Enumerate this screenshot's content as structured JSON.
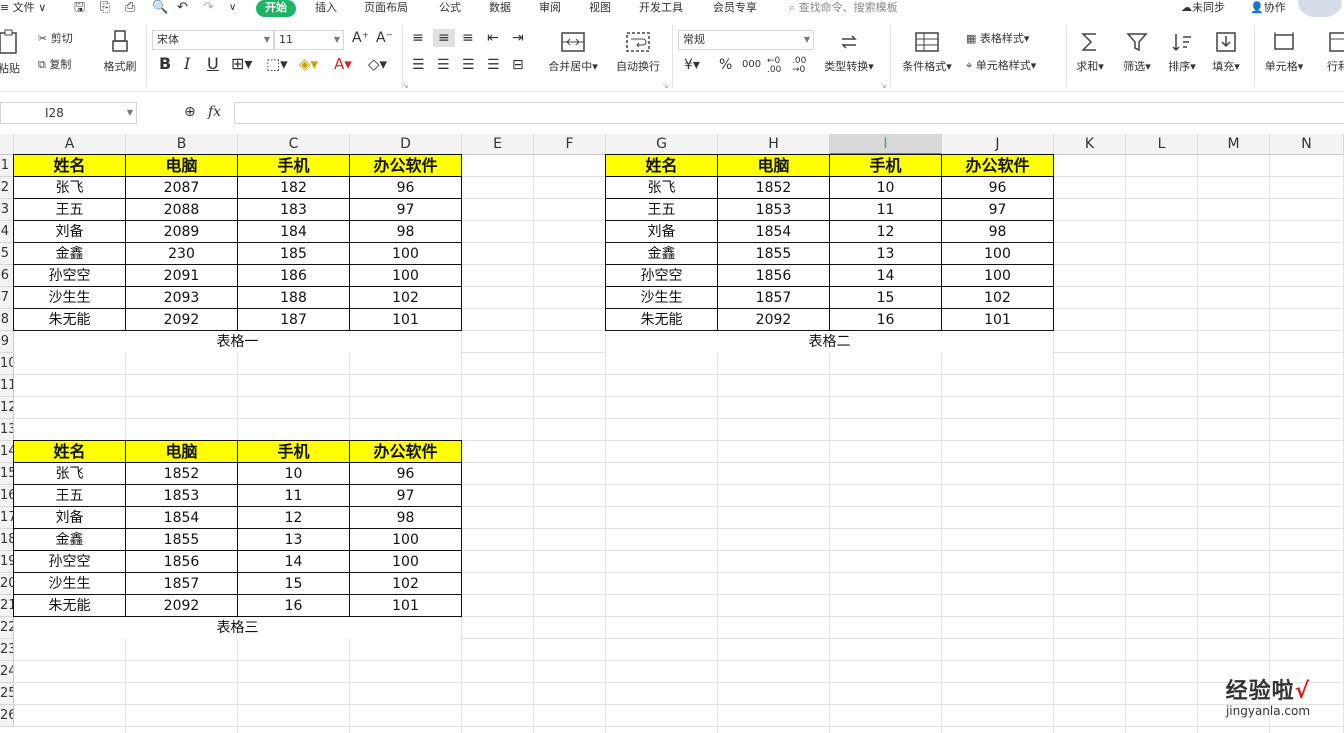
{
  "menubar": {
    "file": "文件",
    "tabs": [
      "开始",
      "插入",
      "页面布局",
      "公式",
      "数据",
      "审阅",
      "视图",
      "开发工具",
      "会员专享"
    ],
    "active_tab": "开始",
    "search_placeholder": "查找命令、搜索模板",
    "sync_status": "未同步",
    "collab": "协作"
  },
  "ribbon": {
    "paste": "粘贴",
    "cut": "剪切",
    "copy": "复制",
    "format_painter": "格式刷",
    "font_name": "宋体",
    "font_size": "11",
    "bold": "B",
    "italic": "I",
    "underline": "U",
    "merge_center": "合并居中",
    "wrap_text": "自动换行",
    "number_format": "常规",
    "currency": "¥",
    "percent": "%",
    "thousands": "000",
    "type_convert": "类型转换",
    "cond_format": "条件格式",
    "table_style": "表格样式",
    "cell_style": "单元格样式",
    "sum": "求和",
    "filter": "筛选",
    "sort": "排序",
    "fill": "填充",
    "cell": "单元格",
    "row_col": "行和"
  },
  "formula_bar": {
    "name_box": "I28",
    "fx_label": "fx",
    "formula": ""
  },
  "columns": [
    "A",
    "B",
    "C",
    "D",
    "E",
    "F",
    "G",
    "H",
    "I",
    "J",
    "K",
    "L",
    "M",
    "N"
  ],
  "selected_column": "I",
  "row_numbers": [
    "1",
    "2",
    "3",
    "4",
    "5",
    "6",
    "7",
    "8",
    "9",
    "10",
    "11",
    "12",
    "13",
    "14",
    "15",
    "16",
    "17",
    "18",
    "19",
    "20",
    "21",
    "22",
    "23",
    "24",
    "25",
    "26"
  ],
  "tables": [
    {
      "caption": "表格一",
      "headers": [
        "姓名",
        "电脑",
        "手机",
        "办公软件"
      ],
      "rows": [
        [
          "张飞",
          "2087",
          "182",
          "96"
        ],
        [
          "王五",
          "2088",
          "183",
          "97"
        ],
        [
          "刘备",
          "2089",
          "184",
          "98"
        ],
        [
          "金鑫",
          "230",
          "185",
          "100"
        ],
        [
          "孙空空",
          "2091",
          "186",
          "100"
        ],
        [
          "沙生生",
          "2093",
          "188",
          "102"
        ],
        [
          "朱无能",
          "2092",
          "187",
          "101"
        ]
      ]
    },
    {
      "caption": "表格二",
      "headers": [
        "姓名",
        "电脑",
        "手机",
        "办公软件"
      ],
      "rows": [
        [
          "张飞",
          "1852",
          "10",
          "96"
        ],
        [
          "王五",
          "1853",
          "11",
          "97"
        ],
        [
          "刘备",
          "1854",
          "12",
          "98"
        ],
        [
          "金鑫",
          "1855",
          "13",
          "100"
        ],
        [
          "孙空空",
          "1856",
          "14",
          "100"
        ],
        [
          "沙生生",
          "1857",
          "15",
          "102"
        ],
        [
          "朱无能",
          "2092",
          "16",
          "101"
        ]
      ]
    },
    {
      "caption": "表格三",
      "headers": [
        "姓名",
        "电脑",
        "手机",
        "办公软件"
      ],
      "rows": [
        [
          "张飞",
          "1852",
          "10",
          "96"
        ],
        [
          "王五",
          "1853",
          "11",
          "97"
        ],
        [
          "刘备",
          "1854",
          "12",
          "98"
        ],
        [
          "金鑫",
          "1855",
          "13",
          "100"
        ],
        [
          "孙空空",
          "1856",
          "14",
          "100"
        ],
        [
          "沙生生",
          "1857",
          "15",
          "102"
        ],
        [
          "朱无能",
          "2092",
          "16",
          "101"
        ]
      ]
    }
  ],
  "watermark": {
    "title": "经验啦",
    "check": "√",
    "url": "jingyanla.com"
  },
  "colors": {
    "accent": "#1db464",
    "header_fill": "#ffff00"
  }
}
